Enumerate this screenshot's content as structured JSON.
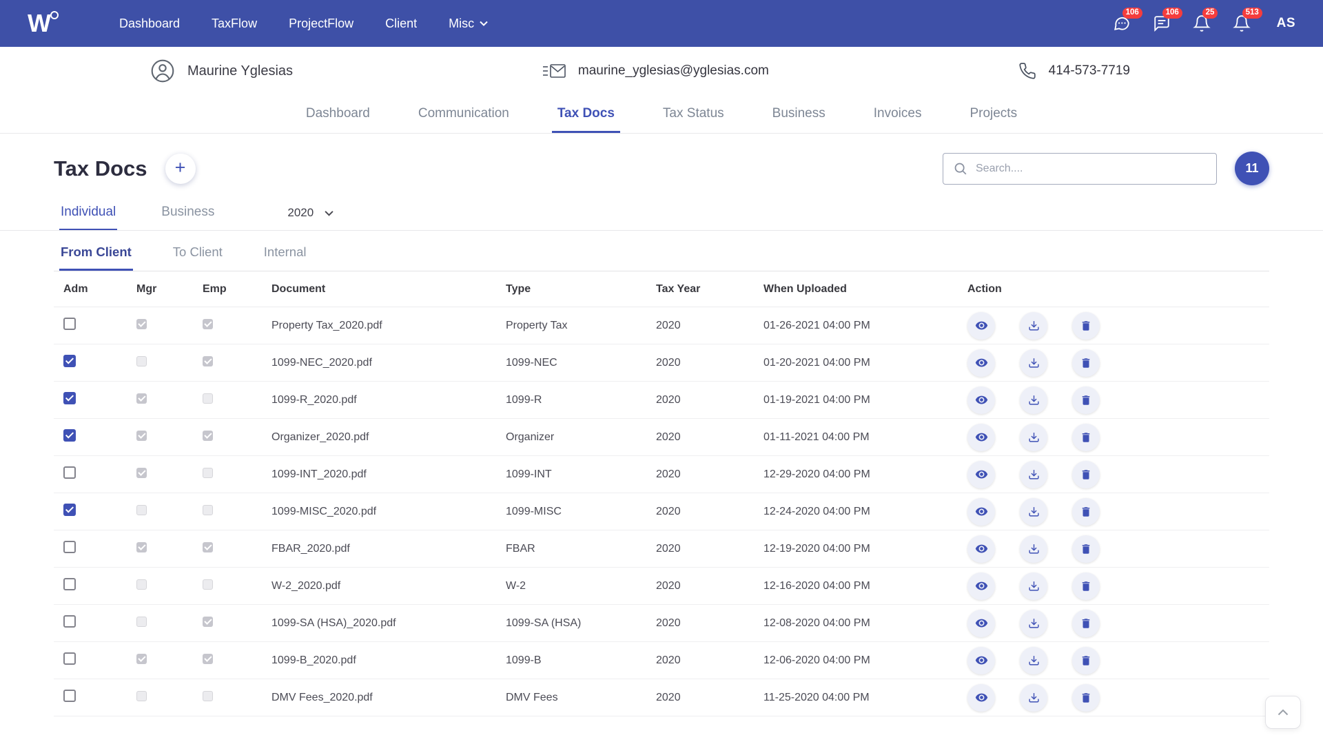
{
  "navbar": {
    "brand": "W",
    "links": [
      "Dashboard",
      "TaxFlow",
      "ProjectFlow",
      "Client",
      "Misc"
    ],
    "notifications": [
      {
        "icon": "chat-dots-icon",
        "count": "106"
      },
      {
        "icon": "chat-lines-icon",
        "count": "106"
      },
      {
        "icon": "bell-icon",
        "count": "25"
      },
      {
        "icon": "bell-icon",
        "count": "513"
      }
    ],
    "avatar_initials": "AS",
    "colors": {
      "background": "#3e50a7",
      "badge": "#f53d3d"
    }
  },
  "client_header": {
    "name": "Maurine Yglesias",
    "email": "maurine_yglesias@yglesias.com",
    "phone": "414-573-7719"
  },
  "profile_tabs": {
    "items": [
      "Dashboard",
      "Communication",
      "Tax Docs",
      "Tax Status",
      "Business",
      "Invoices",
      "Projects"
    ],
    "active": "Tax Docs"
  },
  "page": {
    "title": "Tax Docs",
    "add_button": "+",
    "search_placeholder": "Search....",
    "count_badge": "11",
    "accent_color": "#3f51b5"
  },
  "type_tabs": {
    "items": [
      "Individual",
      "Business"
    ],
    "active": "Individual",
    "year": "2020"
  },
  "source_tabs": {
    "items": [
      "From Client",
      "To Client",
      "Internal"
    ],
    "active": "From Client"
  },
  "table": {
    "headers": [
      "Adm",
      "Mgr",
      "Emp",
      "Document",
      "Type",
      "Tax Year",
      "When Uploaded",
      "Action"
    ],
    "rows": [
      {
        "adm": false,
        "mgr": true,
        "emp": true,
        "document": "Property Tax_2020.pdf",
        "type": "Property Tax",
        "tax_year": "2020",
        "when_uploaded": "01-26-2021 04:00 PM"
      },
      {
        "adm": true,
        "mgr": false,
        "emp": true,
        "document": "1099-NEC_2020.pdf",
        "type": "1099-NEC",
        "tax_year": "2020",
        "when_uploaded": "01-20-2021 04:00 PM"
      },
      {
        "adm": true,
        "mgr": true,
        "emp": false,
        "document": "1099-R_2020.pdf",
        "type": "1099-R",
        "tax_year": "2020",
        "when_uploaded": "01-19-2021 04:00 PM"
      },
      {
        "adm": true,
        "mgr": true,
        "emp": true,
        "document": "Organizer_2020.pdf",
        "type": "Organizer",
        "tax_year": "2020",
        "when_uploaded": "01-11-2021 04:00 PM"
      },
      {
        "adm": false,
        "mgr": true,
        "emp": false,
        "document": "1099-INT_2020.pdf",
        "type": "1099-INT",
        "tax_year": "2020",
        "when_uploaded": "12-29-2020 04:00 PM"
      },
      {
        "adm": true,
        "mgr": false,
        "emp": false,
        "document": "1099-MISC_2020.pdf",
        "type": "1099-MISC",
        "tax_year": "2020",
        "when_uploaded": "12-24-2020 04:00 PM"
      },
      {
        "adm": false,
        "mgr": true,
        "emp": true,
        "document": "FBAR_2020.pdf",
        "type": "FBAR",
        "tax_year": "2020",
        "when_uploaded": "12-19-2020 04:00 PM"
      },
      {
        "adm": false,
        "mgr": false,
        "emp": false,
        "document": "W-2_2020.pdf",
        "type": "W-2",
        "tax_year": "2020",
        "when_uploaded": "12-16-2020 04:00 PM"
      },
      {
        "adm": false,
        "mgr": false,
        "emp": true,
        "document": "1099-SA (HSA)_2020.pdf",
        "type": "1099-SA (HSA)",
        "tax_year": "2020",
        "when_uploaded": "12-08-2020 04:00 PM"
      },
      {
        "adm": false,
        "mgr": true,
        "emp": true,
        "document": "1099-B_2020.pdf",
        "type": "1099-B",
        "tax_year": "2020",
        "when_uploaded": "12-06-2020 04:00 PM"
      },
      {
        "adm": false,
        "mgr": false,
        "emp": false,
        "document": "DMV Fees_2020.pdf",
        "type": "DMV Fees",
        "tax_year": "2020",
        "when_uploaded": "11-25-2020 04:00 PM"
      }
    ]
  }
}
